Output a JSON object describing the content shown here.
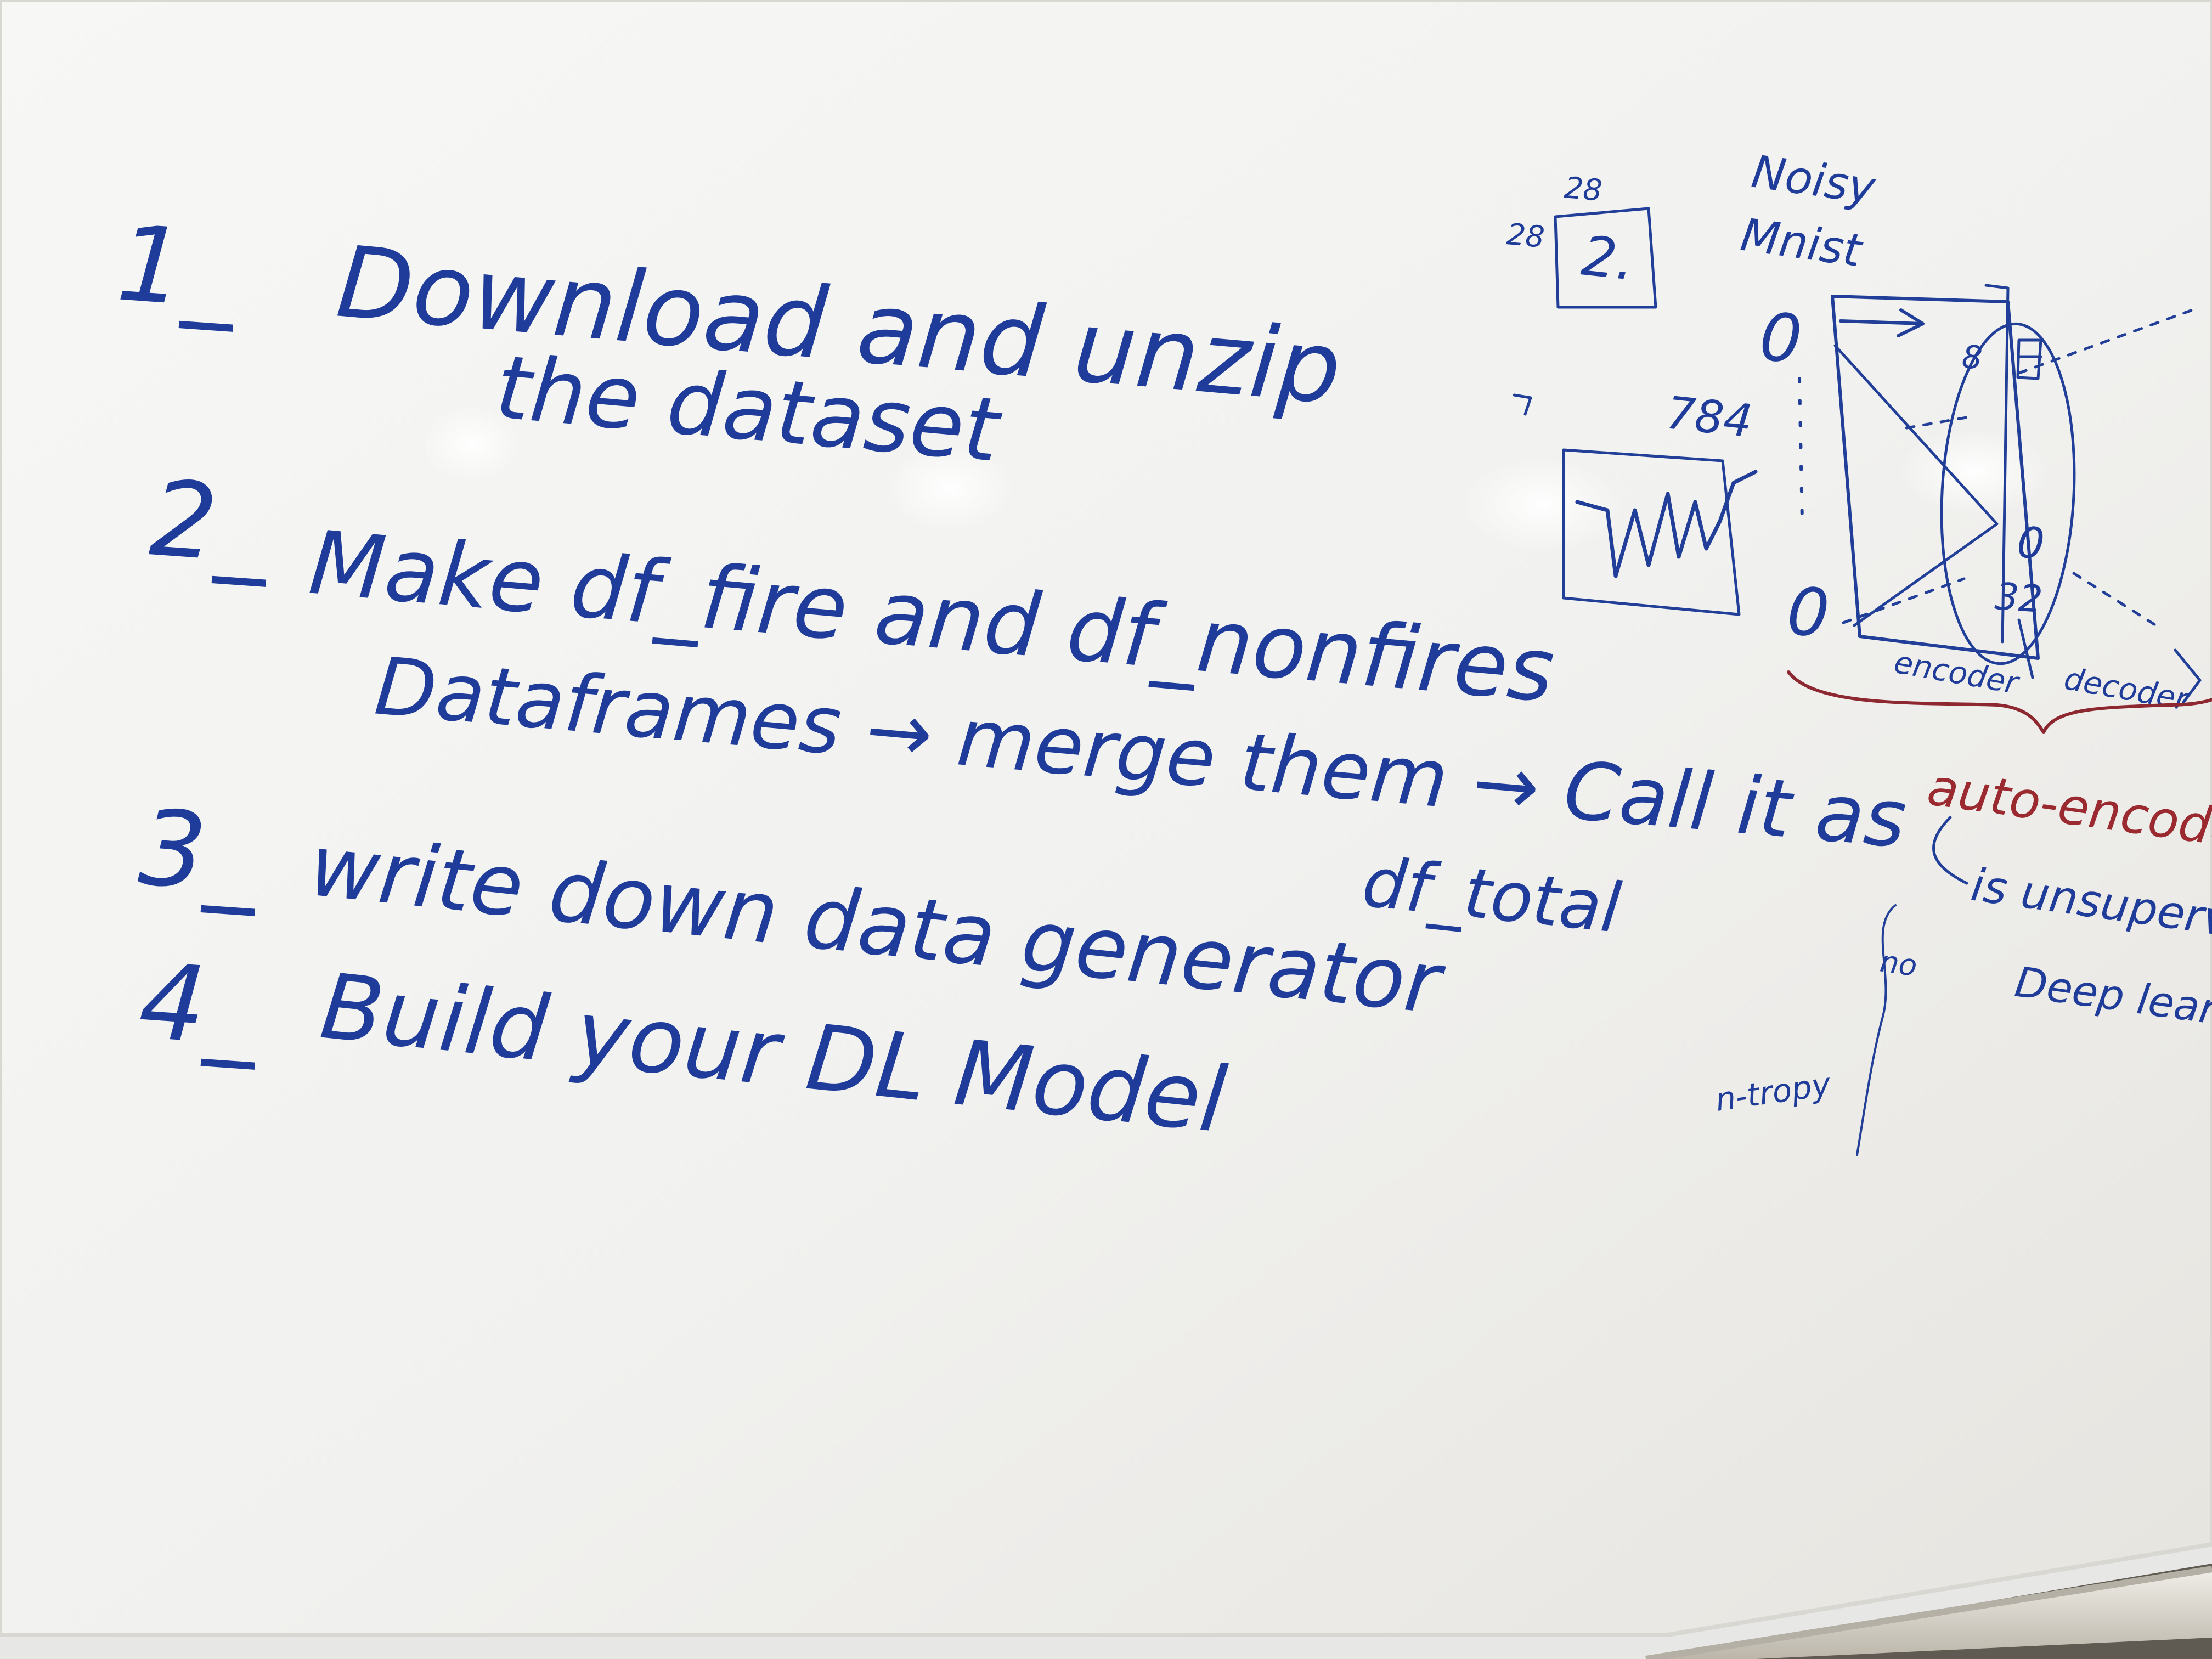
{
  "board": {
    "colors": {
      "wall": "#5f5b52",
      "frame": "#e7e8e6",
      "surface": "#f1f1ef",
      "surface_shadow": "#d8d7d1",
      "marker_blue": "#213f98",
      "marker_red": "#8e2830",
      "tray": "#e4e1da",
      "tray_shadow": "#b5b0a5"
    },
    "tasks": [
      {
        "number": "1_",
        "lines": [
          "Download and unzip",
          "the dataset"
        ]
      },
      {
        "number": "2_",
        "lines": [
          "Make df_fire and df_nonfires",
          "Dataframes → merge them → Call it as",
          "df_total"
        ]
      },
      {
        "number": "3_",
        "lines": [
          "write down data generator"
        ]
      },
      {
        "number": "4_",
        "lines": [
          "Build your DL Model"
        ]
      }
    ],
    "diagram": {
      "noisy_label": "Noisy",
      "mnist_label": "Mnist",
      "size_top": "28",
      "size_side": "28",
      "image_digit": "2.",
      "input_size": "784",
      "node_8": "8",
      "node_32": "32",
      "zero_1": "0",
      "zero_2": "0",
      "zero_3": "0",
      "encoder_label": "encoder",
      "decoder_label": "decoder",
      "autoencoder_label": "auto-encoder",
      "autoencoder_note_1": "is unsupervised",
      "autoencoder_note_2": "Deep learning",
      "side_note": "n-tropy",
      "side_note_2": "no"
    }
  }
}
